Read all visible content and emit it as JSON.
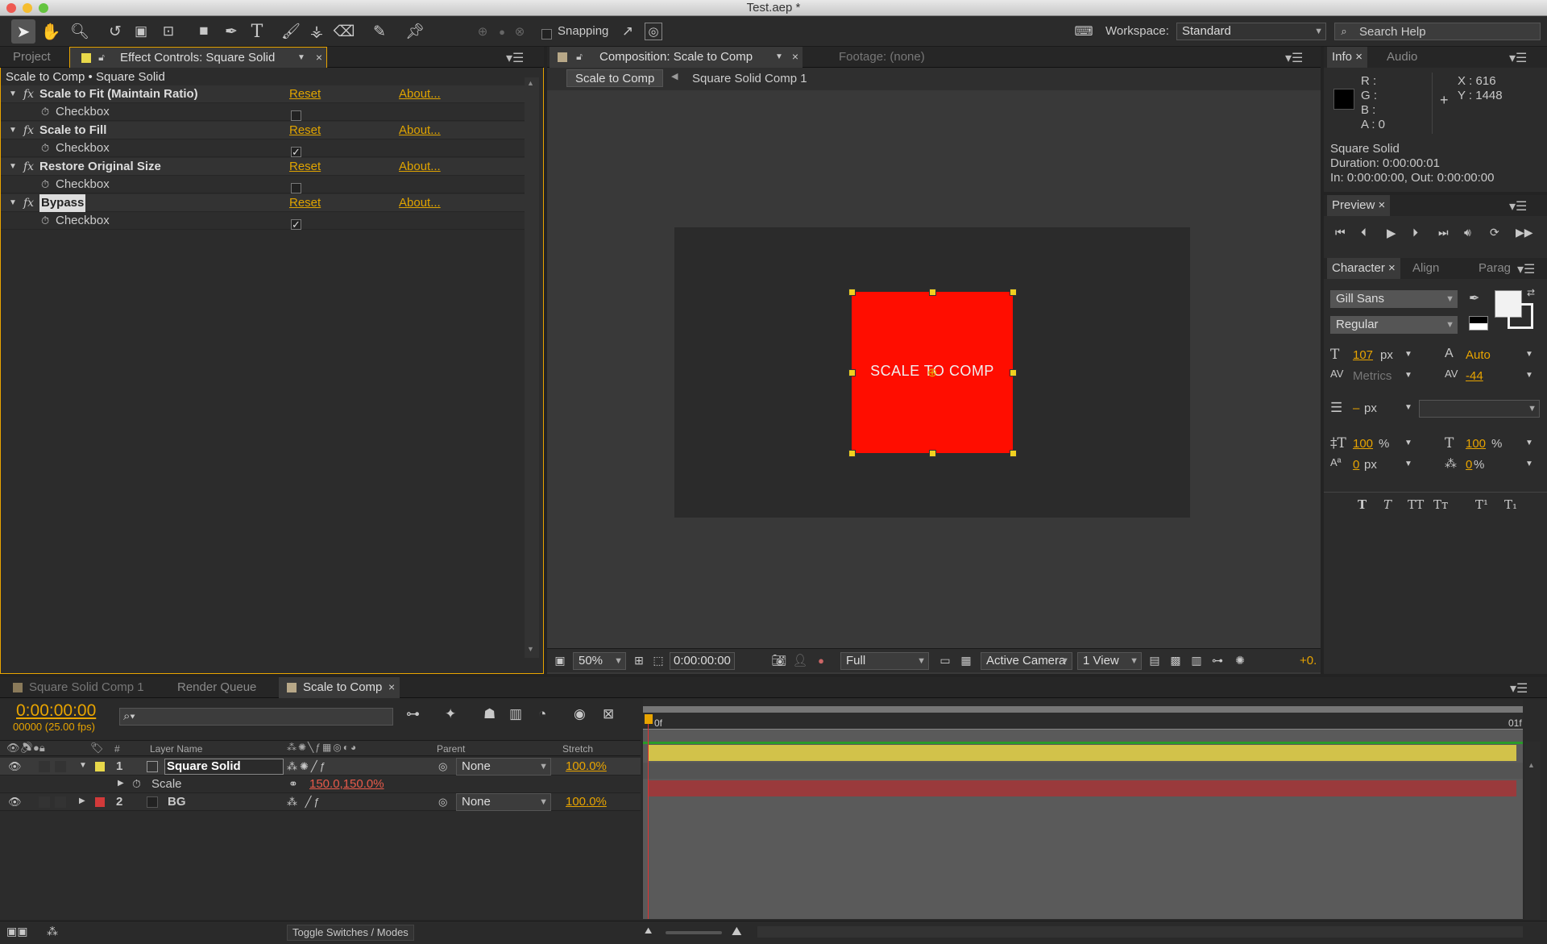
{
  "window": {
    "title": "Test.aep *"
  },
  "toolbar": {
    "snapping_label": "Snapping",
    "snapping_checked": false,
    "workspace_label": "Workspace:",
    "workspace_value": "Standard",
    "search_placeholder": "Search Help"
  },
  "left_panel": {
    "tabs": [
      "Project",
      "Effect Controls: Square Solid"
    ],
    "breadcrumb": "Scale to Comp • Square Solid",
    "effects": [
      {
        "name": "Scale to Fit (Maintain Ratio)",
        "reset": "Reset",
        "about": "About...",
        "param": "Checkbox",
        "checked": false
      },
      {
        "name": "Scale to Fill",
        "reset": "Reset",
        "about": "About...",
        "param": "Checkbox",
        "checked": true
      },
      {
        "name": "Restore Original Size",
        "reset": "Reset",
        "about": "About...",
        "param": "Checkbox",
        "checked": false
      },
      {
        "name": "Bypass",
        "reset": "Reset",
        "about": "About...",
        "param": "Checkbox",
        "checked": true
      }
    ]
  },
  "comp_panel": {
    "tab_label": "Composition: Scale to Comp",
    "footage_tab": "Footage: (none)",
    "flow": [
      "Scale to Comp",
      "Square Solid Comp 1"
    ],
    "solid_text": "SCALE TO COMP",
    "solid_color": "#ff0d00",
    "zoom": "50%",
    "timecode": "0:00:00:00",
    "resolution": "Full",
    "camera": "Active Camera",
    "views": "1 View",
    "exposure": "+0."
  },
  "info_panel": {
    "tabs": [
      "Info",
      "Audio"
    ],
    "r": "R :",
    "g": "G :",
    "b": "B :",
    "a": "A : 0",
    "x": "X : 616",
    "y": "Y : 1448",
    "layer_name": "Square Solid",
    "duration": "Duration: 0:00:00:01",
    "in_out": "In: 0:00:00:00, Out: 0:00:00:00"
  },
  "preview_panel": {
    "tab": "Preview"
  },
  "character_panel": {
    "tabs": [
      "Character",
      "Align",
      "Parag"
    ],
    "font": "Gill Sans",
    "style": "Regular",
    "size": "107",
    "size_unit": "px",
    "leading": "Auto",
    "kerning": "Metrics",
    "tracking": "-44",
    "stroke": "–",
    "stroke_unit": "px",
    "vscale": "100",
    "hscale": "100",
    "pct": "%",
    "baseline": "0",
    "baseline_unit": "px",
    "tsume": "0",
    "style_buttons": [
      "T",
      "T",
      "TT",
      "Tт",
      "T¹",
      "T₁"
    ]
  },
  "timeline": {
    "tabs": [
      "Square Solid Comp 1",
      "Render Queue",
      "Scale to Comp"
    ],
    "timecode": "0:00:00:00",
    "fps": "00000 (25.00 fps)",
    "col_layer_name": "Layer Name",
    "col_num": "#",
    "col_parent": "Parent",
    "col_stretch": "Stretch",
    "ruler_start": "0f",
    "ruler_end": "01f",
    "layers": [
      {
        "num": "1",
        "name": "Square Solid",
        "parent": "None",
        "stretch": "100.0%",
        "label_color": "#e8d84a",
        "bar_color": "#d2c24a"
      },
      {
        "num": "2",
        "name": "BG",
        "parent": "None",
        "stretch": "100.0%",
        "label_color": "#d23a3a",
        "bar_color": "#9a3a3c"
      }
    ],
    "scale_prop": "Scale",
    "scale_value": "150.0,150.0%",
    "toggle_label": "Toggle Switches / Modes"
  }
}
